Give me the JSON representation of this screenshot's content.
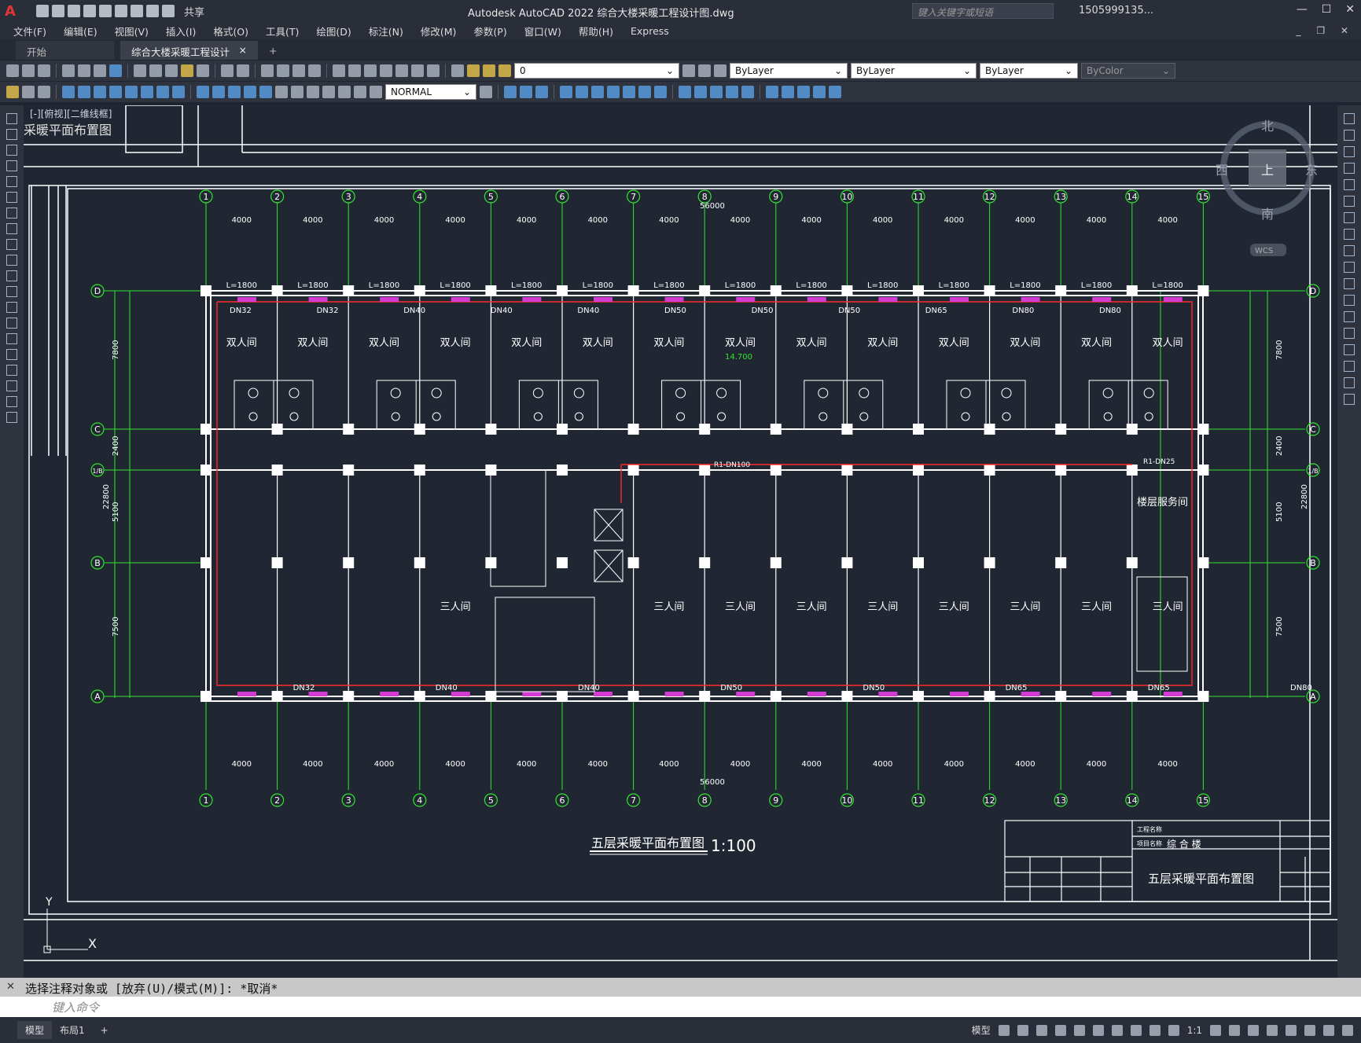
{
  "app": {
    "title": "Autodesk AutoCAD 2022    综合大楼采暖工程设计图.dwg",
    "share_label": "共享",
    "search_placeholder": "键入关键字或短语",
    "user": "1505999135...",
    "logo": "A"
  },
  "menu": [
    "文件(F)",
    "编辑(E)",
    "视图(V)",
    "插入(I)",
    "格式(O)",
    "工具(T)",
    "绘图(D)",
    "标注(N)",
    "修改(M)",
    "参数(P)",
    "窗口(W)",
    "帮助(H)",
    "Express"
  ],
  "tabs": {
    "start": "开始",
    "active": "综合大楼采暖工程设计图*",
    "close": "×",
    "add": "+"
  },
  "toolbar": {
    "layer_value": "0",
    "color_value": "ByLayer",
    "linetype_value": "ByLayer",
    "lineweight_value": "ByLayer",
    "plotstyle_value": "ByColor",
    "textstyle_value": "NORMAL"
  },
  "viewport": {
    "label": "[-][俯视][二维线框]",
    "sheet_title_fragment": "采暖平面布置图"
  },
  "drawing": {
    "title": "五层采暖平面布置图",
    "scale": "1:100",
    "total_dim": "56000",
    "bay_dim": "4000",
    "axes_numbers": [
      "1",
      "2",
      "3",
      "4",
      "5",
      "6",
      "7",
      "8",
      "9",
      "10",
      "11",
      "12",
      "13",
      "14",
      "15"
    ],
    "axes_letters": [
      "D",
      "C",
      "1/B",
      "B",
      "A"
    ],
    "room_double": "双人间",
    "room_triple": "三人间",
    "service_room": "楼层服务间",
    "radiator_label": "L=1800",
    "pipes_top": [
      "DN32",
      "DN32",
      "DN40",
      "DN40",
      "DN40",
      "DN50",
      "DN50",
      "DN50",
      "DN65",
      "DN80",
      "DN80"
    ],
    "pipes_bottom": [
      "DN32",
      "DN40",
      "DN40",
      "DN50",
      "DN50",
      "DN65",
      "DN65",
      "DN80"
    ],
    "main_pipe": "R1-DN100",
    "main_pipe_2": "R1-DN25",
    "left_dims": [
      "7800",
      "2400",
      "5100",
      "7500",
      "22800"
    ],
    "elev": "14.700",
    "title_block": {
      "project_label": "工程名称",
      "item_label": "项目名称",
      "item_value": "综 合 楼",
      "sheet_name": "五层采暖平面布置图"
    },
    "compass": {
      "north": "北",
      "south": "南",
      "east": "东",
      "west": "西",
      "top": "上",
      "wcs": "WCS"
    }
  },
  "command": {
    "history": "选择注释对象或 [放弃(U)/模式(M)]: *取消*",
    "placeholder": "键入命令"
  },
  "status": {
    "model": "模型",
    "layout": "布局1",
    "add": "+",
    "model_btn": "模型",
    "scale": "1:1"
  }
}
